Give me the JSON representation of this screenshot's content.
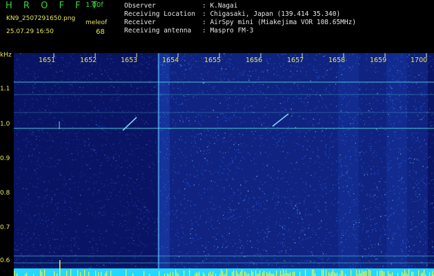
{
  "app": {
    "logo": "H R O F F T",
    "version": "1.00f",
    "filename": "KN9_2507291650.png",
    "timestamp": "25.07.29 16:50",
    "meleof_label": "meleof",
    "meleof_value": "68"
  },
  "info": {
    "observer_label": "Observer",
    "observer_value": ": K.Nagai",
    "location_label": "Receiving Location",
    "location_value": ": Chigasaki, Japan (139.414 35.340)",
    "receiver_label": "Receiver",
    "receiver_value": ": AirSpy mini (Miakejima VOR 108.65MHz)",
    "antenna_label": "Receiving antenna",
    "antenna_value": ": Maspro FM-3"
  },
  "axis": {
    "unit": "kHz",
    "y_ticks": [
      "1.1",
      "1.0",
      "0.9",
      "0.8",
      "0.7",
      "0.6"
    ],
    "x_ticks": [
      "1651",
      "1652",
      "1653",
      "1654",
      "1655",
      "1656",
      "1657",
      "1658",
      "1659",
      "1700"
    ]
  },
  "colors": {
    "background": "#0a1464",
    "noise": "#2a6cff",
    "signal_line": "#4dd8e0",
    "baseline": "#22d8ff",
    "baseline_spikes": "#f2f23a",
    "text_yellow": "#e8e85a",
    "text_green": "#36d63a"
  }
}
